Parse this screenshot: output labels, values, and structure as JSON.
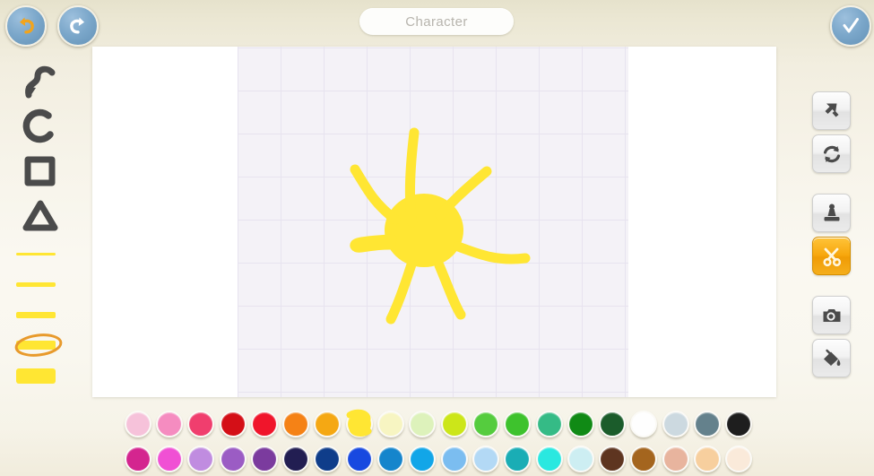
{
  "app": {
    "background_color": "#f7f4ea",
    "accent_color": "#f5a80c"
  },
  "topbar": {
    "undo_label": "Undo",
    "redo_label": "Redo",
    "confirm_label": "Done",
    "undo_icon": "undo-arrow-icon",
    "redo_icon": "redo-arrow-icon",
    "confirm_icon": "checkmark-icon",
    "title_value": "Character",
    "title_placeholder": "Character"
  },
  "left_toolbar": {
    "shape_tools": [
      {
        "name": "squiggle-tool",
        "label": "Squiggle",
        "selected": false
      },
      {
        "name": "circle-tool",
        "label": "Circle",
        "selected": false
      },
      {
        "name": "square-tool",
        "label": "Square",
        "selected": false
      },
      {
        "name": "triangle-tool",
        "label": "Triangle",
        "selected": false
      }
    ],
    "thickness_tools": [
      {
        "label": "Thin",
        "thickness": 3,
        "width": 44,
        "selected": false
      },
      {
        "label": "Medium",
        "thickness": 5,
        "width": 44,
        "selected": false
      },
      {
        "label": "Thick",
        "thickness": 7,
        "width": 44,
        "selected": false
      },
      {
        "label": "Extra Thick",
        "thickness": 9,
        "width": 44,
        "selected": true
      },
      {
        "label": "Fill",
        "thickness": 17,
        "width": 44,
        "selected": false
      }
    ],
    "selection_color": "#e89a2c",
    "stroke_color": "#ffe633"
  },
  "right_toolbar": {
    "tools": [
      {
        "name": "select-arrow-tool",
        "label": "Select",
        "icon": "cursor-arrow-icon",
        "selected": false
      },
      {
        "name": "rotate-tool",
        "label": "Rotate",
        "icon": "rotate-refresh-icon",
        "selected": false
      },
      {
        "name": "stamp-tool",
        "label": "Stamp",
        "icon": "stamp-icon",
        "selected": false
      },
      {
        "name": "scissors-tool",
        "label": "Cut",
        "icon": "scissors-icon",
        "selected": true
      },
      {
        "name": "camera-tool",
        "label": "Camera",
        "icon": "camera-icon",
        "selected": false
      },
      {
        "name": "fill-tool",
        "label": "Fill",
        "icon": "paint-bucket-icon",
        "selected": false
      }
    ]
  },
  "canvas": {
    "background_color": "#ffffff",
    "grid_color": "#e7e3ef",
    "grid_background": "#f4f2f7",
    "grid_spacing": 48,
    "drawing_name": "sun-drawing",
    "drawing_color": "#ffe633",
    "drawing_description": "Hand-drawn yellow sun with round body and seven rays"
  },
  "palette": {
    "selected_index": 7,
    "selected_row": 0,
    "row1": [
      {
        "hex": "#f6c2da",
        "label": "Light Pink"
      },
      {
        "hex": "#f58cc0",
        "label": "Pink"
      },
      {
        "hex": "#f03e6e",
        "label": "Rose"
      },
      {
        "hex": "#d40f17",
        "label": "Dark Red"
      },
      {
        "hex": "#f0152b",
        "label": "Red"
      },
      {
        "hex": "#f58216",
        "label": "Orange"
      },
      {
        "hex": "#f5a813",
        "label": "Amber"
      },
      {
        "hex": "#ffe633",
        "label": "Yellow"
      },
      {
        "hex": "#f7f5c2",
        "label": "Pale Yellow"
      },
      {
        "hex": "#ddf2bb",
        "label": "Pale Green"
      },
      {
        "hex": "#cce619",
        "label": "Lime"
      },
      {
        "hex": "#55cc3e",
        "label": "Light Green"
      },
      {
        "hex": "#3ec22d",
        "label": "Green"
      },
      {
        "hex": "#35bb86",
        "label": "Emerald"
      },
      {
        "hex": "#108a15",
        "label": "Dark Green"
      },
      {
        "hex": "#1b5c2b",
        "label": "Forest Green"
      },
      {
        "hex": "#fefefe",
        "label": "White"
      },
      {
        "hex": "#ccd9e0",
        "label": "Pale Blue Gray"
      },
      {
        "hex": "#64818c",
        "label": "Slate Gray"
      },
      {
        "hex": "#1e1e1e",
        "label": "Black"
      }
    ],
    "row2": [
      {
        "hex": "#d4258f",
        "label": "Magenta"
      },
      {
        "hex": "#f050d4",
        "label": "Bright Magenta"
      },
      {
        "hex": "#c08ce0",
        "label": "Light Purple"
      },
      {
        "hex": "#9b5cc4",
        "label": "Purple"
      },
      {
        "hex": "#7b3b9e",
        "label": "Dark Purple"
      },
      {
        "hex": "#221e52",
        "label": "Navy Indigo"
      },
      {
        "hex": "#0f3d8a",
        "label": "Dark Blue"
      },
      {
        "hex": "#1849e0",
        "label": "Blue"
      },
      {
        "hex": "#1585cc",
        "label": "Ocean Blue"
      },
      {
        "hex": "#12a6e8",
        "label": "Sky Blue"
      },
      {
        "hex": "#7bbdf0",
        "label": "Light Sky Blue"
      },
      {
        "hex": "#b3d9f5",
        "label": "Pale Sky"
      },
      {
        "hex": "#1aadb5",
        "label": "Teal"
      },
      {
        "hex": "#2ae8e0",
        "label": "Cyan"
      },
      {
        "hex": "#cdeef2",
        "label": "Pale Cyan"
      },
      {
        "hex": "#5e3520",
        "label": "Dark Brown"
      },
      {
        "hex": "#a4651e",
        "label": "Brown"
      },
      {
        "hex": "#e8b49e",
        "label": "Peach"
      },
      {
        "hex": "#f7cf9e",
        "label": "Light Peach"
      },
      {
        "hex": "#faeada",
        "label": "Cream"
      }
    ]
  }
}
